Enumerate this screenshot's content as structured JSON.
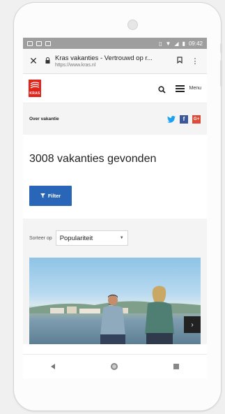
{
  "status": {
    "time": "09:42"
  },
  "browser": {
    "tab_title": "Kras vakanties - Vertrouwd op r...",
    "url": "https://www.kras.nl"
  },
  "site": {
    "logo_text": "KRAS",
    "menu_label": "Menu"
  },
  "breadcrumb": {
    "label": "Over vakantie"
  },
  "social": {
    "facebook": "f",
    "google": "G+"
  },
  "results": {
    "title": "3008 vakanties gevonden",
    "filter_label": "Filter"
  },
  "sort": {
    "label": "Sorteer op",
    "selected": "Populariteit"
  },
  "hero": {
    "next_label": "›"
  },
  "colors": {
    "brand_red": "#e2231a",
    "filter_blue": "#2a66b8",
    "facebook": "#3b5998",
    "google": "#dd4b39",
    "twitter": "#1da1f2"
  }
}
